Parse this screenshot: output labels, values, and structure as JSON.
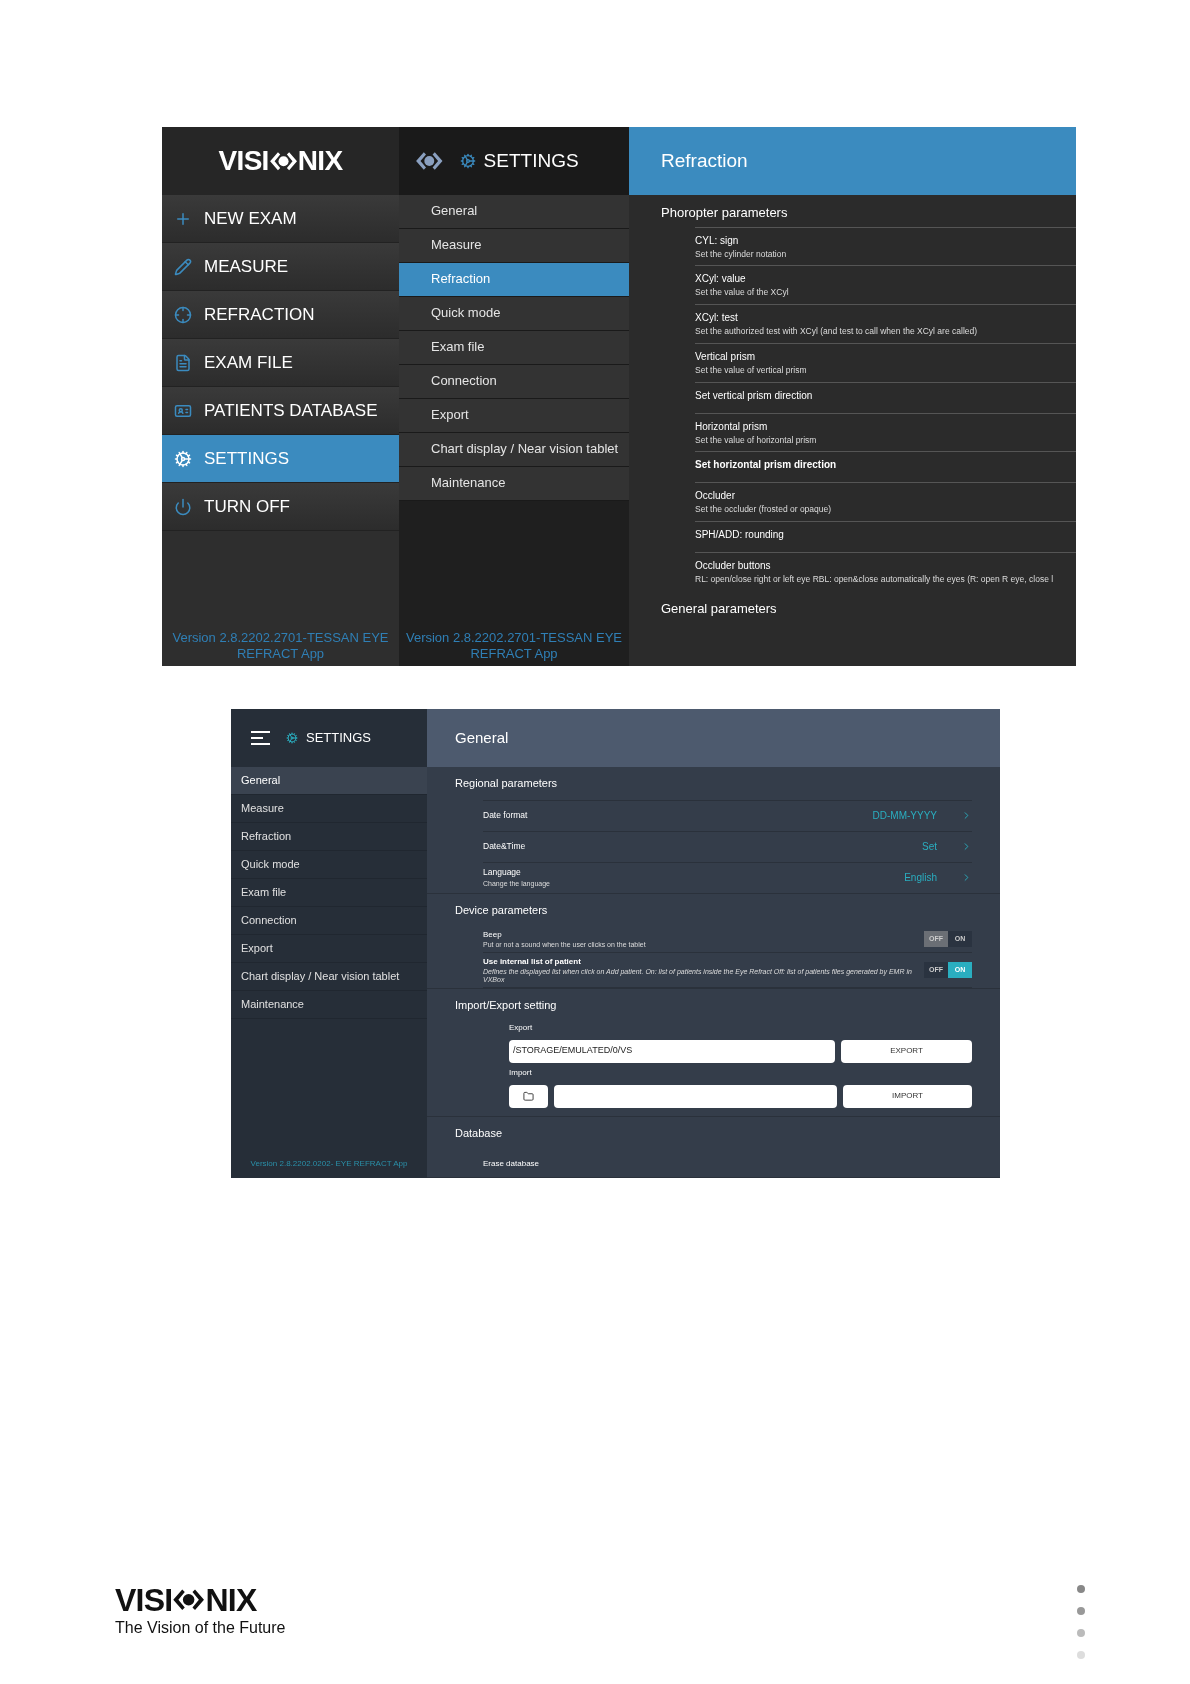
{
  "screenshot_1": {
    "logo": {
      "left": "VISI",
      "right": "NIX"
    },
    "main_menu": [
      {
        "label": "NEW EXAM",
        "selected": false
      },
      {
        "label": "MEASURE",
        "selected": false
      },
      {
        "label": "REFRACTION",
        "selected": false
      },
      {
        "label": "EXAM FILE",
        "selected": false
      },
      {
        "label": "PATIENTS DATABASE",
        "selected": false
      },
      {
        "label": "SETTINGS",
        "selected": true
      },
      {
        "label": "TURN OFF",
        "selected": false
      }
    ],
    "main_version": "Version 2.8.2202.2701-TESSAN  EYE REFRACT App",
    "settings_title": "SETTINGS",
    "settings_menu": [
      {
        "label": "General",
        "selected": false
      },
      {
        "label": "Measure",
        "selected": false
      },
      {
        "label": "Refraction",
        "selected": true
      },
      {
        "label": "Quick mode",
        "selected": false
      },
      {
        "label": "Exam file",
        "selected": false
      },
      {
        "label": "Connection",
        "selected": false
      },
      {
        "label": "Export",
        "selected": false
      },
      {
        "label": "Chart display / Near vision tablet",
        "selected": false
      },
      {
        "label": "Maintenance",
        "selected": false
      }
    ],
    "settings_version": "Version 2.8.2202.2701-TESSAN  EYE REFRACT App",
    "panel_title": "Refraction",
    "sections": [
      {
        "title": "Phoropter parameters",
        "items": [
          {
            "title": "CYL: sign",
            "description": "Set the cylinder notation",
            "bold": false
          },
          {
            "title": "XCyl: value",
            "description": "Set the value of the XCyl",
            "bold": false
          },
          {
            "title": "XCyl: test",
            "description": "Set the authorized test with XCyl (and test to call when the XCyl are called)",
            "bold": false
          },
          {
            "title": "Vertical prism",
            "description": "Set the value of vertical prism",
            "bold": false
          },
          {
            "title": "Set vertical prism direction",
            "bold": false
          },
          {
            "title": "Horizontal prism",
            "description": "Set the value of horizontal prism",
            "bold": false
          },
          {
            "title": "Set horizontal prism direction",
            "bold": true
          },
          {
            "title": "Occluder",
            "description": "Set the occluder (frosted or opaque)",
            "bold": false
          },
          {
            "title": "SPH/ADD: rounding",
            "bold": false
          },
          {
            "title": "Occluder buttons",
            "description": "RL: open/close right or left eye RBL: open&close automatically the eyes (R: open R eye, close l",
            "bold": false
          }
        ]
      },
      {
        "title": "General parameters"
      }
    ]
  },
  "screenshot_2": {
    "settings_title": "SETTINGS",
    "settings_menu": [
      {
        "label": "General",
        "selected": true
      },
      {
        "label": "Measure",
        "selected": false
      },
      {
        "label": "Refraction",
        "selected": false
      },
      {
        "label": "Quick mode",
        "selected": false
      },
      {
        "label": "Exam file",
        "selected": false
      },
      {
        "label": "Connection",
        "selected": false
      },
      {
        "label": "Export",
        "selected": false
      },
      {
        "label": "Chart display / Near vision tablet",
        "selected": false
      },
      {
        "label": "Maintenance",
        "selected": false
      }
    ],
    "version": "Version 2.8.2202.0202- EYE REFRACT App",
    "panel_title": "General",
    "sections": [
      {
        "title": "Regional parameters",
        "rows": [
          {
            "kind": "link",
            "title": "Date format",
            "value": "DD-MM-YYYY"
          },
          {
            "kind": "link",
            "title": "Date&Time",
            "value": "Set"
          },
          {
            "kind": "link",
            "title": "Language",
            "description": "Change the language",
            "value": "English"
          }
        ]
      },
      {
        "title": "Device parameters",
        "rows": [
          {
            "kind": "toggle",
            "title": "Beep",
            "description": "Put or not a sound when the user clicks on the tablet",
            "off_label": "OFF",
            "on_label": "ON",
            "on": false
          },
          {
            "kind": "toggle",
            "title": "Use internal list of patient",
            "description": "Defines the displayed list when click on Add patient. On: list of patients inside the Eye Refract Off: list of patients files generated by EMR in VXBox",
            "off_label": "OFF",
            "on_label": "ON",
            "on": true
          }
        ]
      },
      {
        "title": "Import/Export setting",
        "rows": [
          {
            "kind": "export",
            "label": "Export",
            "value": "/STORAGE/EMULATED/0/VS",
            "button": "EXPORT"
          },
          {
            "kind": "import",
            "label": "Import",
            "button": "IMPORT"
          }
        ]
      },
      {
        "title": "Database",
        "rows": [
          {
            "kind": "plain",
            "title": "Erase database"
          }
        ]
      }
    ]
  },
  "footer": {
    "logo": {
      "left": "VISI",
      "right": "NIX"
    },
    "tagline": "The Vision of the Future"
  }
}
